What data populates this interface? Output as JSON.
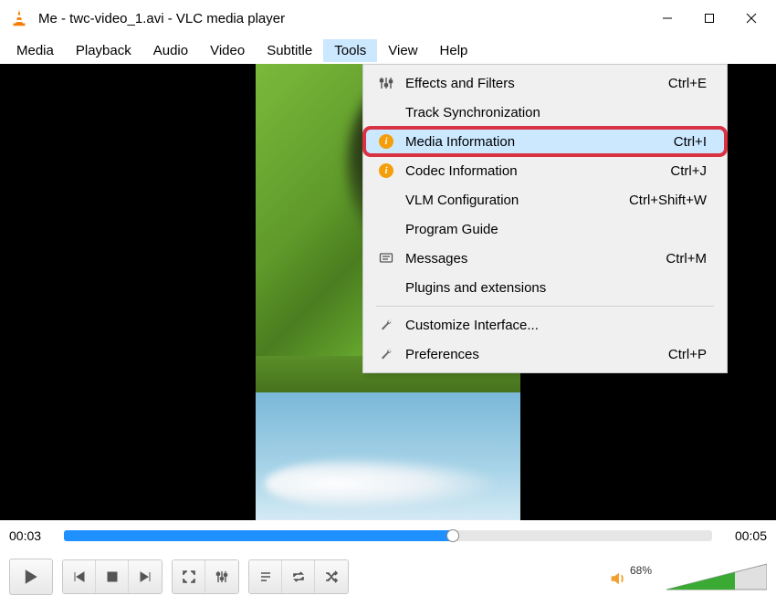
{
  "titlebar": {
    "title": "Me - twc-video_1.avi - VLC media player"
  },
  "menubar": {
    "items": [
      {
        "label": "Media",
        "active": false
      },
      {
        "label": "Playback",
        "active": false
      },
      {
        "label": "Audio",
        "active": false
      },
      {
        "label": "Video",
        "active": false
      },
      {
        "label": "Subtitle",
        "active": false
      },
      {
        "label": "Tools",
        "active": true
      },
      {
        "label": "View",
        "active": false
      },
      {
        "label": "Help",
        "active": false
      }
    ]
  },
  "dropdown": {
    "items": [
      {
        "icon": "sliders",
        "label": "Effects and Filters",
        "shortcut": "Ctrl+E",
        "highlight": false
      },
      {
        "icon": "",
        "label": "Track Synchronization",
        "shortcut": "",
        "highlight": false
      },
      {
        "icon": "info",
        "label": "Media Information",
        "shortcut": "Ctrl+I",
        "highlight": true
      },
      {
        "icon": "info",
        "label": "Codec Information",
        "shortcut": "Ctrl+J",
        "highlight": false
      },
      {
        "icon": "",
        "label": "VLM Configuration",
        "shortcut": "Ctrl+Shift+W",
        "highlight": false
      },
      {
        "icon": "",
        "label": "Program Guide",
        "shortcut": "",
        "highlight": false
      },
      {
        "icon": "messages",
        "label": "Messages",
        "shortcut": "Ctrl+M",
        "highlight": false
      },
      {
        "icon": "",
        "label": "Plugins and extensions",
        "shortcut": "",
        "highlight": false
      }
    ],
    "items2": [
      {
        "icon": "wrench",
        "label": "Customize Interface...",
        "shortcut": ""
      },
      {
        "icon": "wrench",
        "label": "Preferences",
        "shortcut": "Ctrl+P"
      }
    ]
  },
  "playback": {
    "current_time": "00:03",
    "total_time": "00:05",
    "progress_percent": 60
  },
  "volume": {
    "percent_label": "68%",
    "percent_value": 68
  }
}
